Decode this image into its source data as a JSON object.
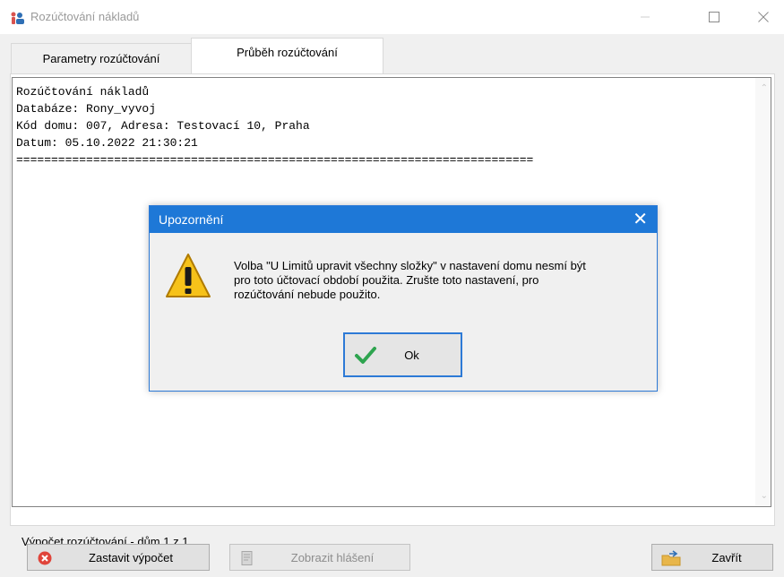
{
  "window": {
    "title": "Rozúčtování nákladů"
  },
  "tabs": [
    {
      "label": "Parametry rozúčtování"
    },
    {
      "label": "Průběh rozúčtování"
    }
  ],
  "log": {
    "lines": [
      "Rozúčtování nákladů",
      "Databáze: Rony_vyvoj",
      "Kód domu: 007, Adresa: Testovací 10, Praha",
      "Datum: 05.10.2022 21:30:21",
      "=========================================================================="
    ]
  },
  "status": {
    "text": "Výpočet rozúčtování -  dům 1 z 1"
  },
  "buttons": {
    "stop": "Zastavit výpočet",
    "report": "Zobrazit hlášení",
    "close": "Zavřít"
  },
  "dialog": {
    "title": "Upozornění",
    "message_lines": [
      "Volba \"U Limitů upravit všechny složky\" v nastavení domu nesmí být",
      "pro toto účtovací období použita. Zrušte toto nastavení, pro",
      "rozúčtování nebude použito."
    ],
    "ok_label": "Ok"
  },
  "colors": {
    "accent": "#1e78d7",
    "stop_icon": "#e0443a",
    "ok_check": "#2ea44f",
    "warning": "#f2b705"
  }
}
